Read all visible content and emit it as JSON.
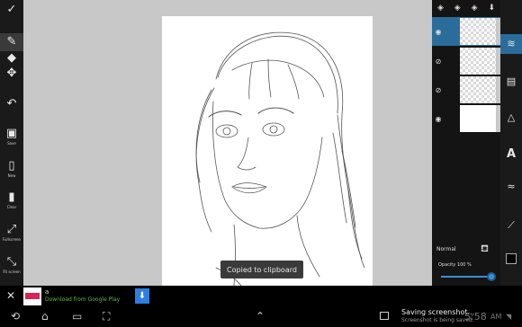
{
  "left_toolbar": {
    "tools": [
      {
        "name": "done",
        "glyph": "✓",
        "label": ""
      },
      {
        "name": "brush",
        "glyph": "✎",
        "label": ""
      },
      {
        "name": "eraser",
        "glyph": "◆",
        "label": ""
      },
      {
        "name": "move",
        "glyph": "✥",
        "label": ""
      },
      {
        "name": "undo",
        "glyph": "↶",
        "label": ""
      },
      {
        "name": "save",
        "glyph": "▣",
        "label": "Save"
      },
      {
        "name": "new",
        "glyph": "▯",
        "label": "New"
      },
      {
        "name": "clear",
        "glyph": "▮",
        "label": "Clear"
      },
      {
        "name": "fullscreen",
        "glyph": "⤢",
        "label": "Fullscreen"
      },
      {
        "name": "fit-screen",
        "glyph": "⤡",
        "label": "Fit screen"
      }
    ]
  },
  "toast": {
    "text": "Copied to clipboard"
  },
  "layers": {
    "header_icons": [
      "◈",
      "◈",
      "◈",
      "⬇"
    ],
    "rows": [
      {
        "visible_icon": "◉",
        "thumb": "transparent",
        "selected": true
      },
      {
        "visible_icon": "⊘",
        "thumb": "transparent",
        "selected": false
      },
      {
        "visible_icon": "⊘",
        "thumb": "transparent",
        "selected": false
      },
      {
        "visible_icon": "◉",
        "thumb": "white",
        "selected": false
      }
    ],
    "blend_mode": "Normal",
    "opacity_label": "Opacity 100 %",
    "opacity": 1.0
  },
  "right_toolbar": {
    "tools": [
      {
        "name": "layers",
        "glyph": "≋"
      },
      {
        "name": "import",
        "glyph": "▤"
      },
      {
        "name": "shapes",
        "glyph": "△"
      },
      {
        "name": "text",
        "glyph": "A"
      },
      {
        "name": "brush-settings",
        "glyph": "≈"
      },
      {
        "name": "eyedropper",
        "glyph": "⟋"
      }
    ],
    "current_color": "#000000"
  },
  "ad": {
    "close_glyph": "✕",
    "title": "a",
    "subtitle": "Download from Google Play",
    "button_glyph": "⬇"
  },
  "system_bar": {
    "notification_title": "Saving screenshot...",
    "notification_sub": "Screenshot is being saved.",
    "clock": "5:58",
    "status": "AM"
  }
}
